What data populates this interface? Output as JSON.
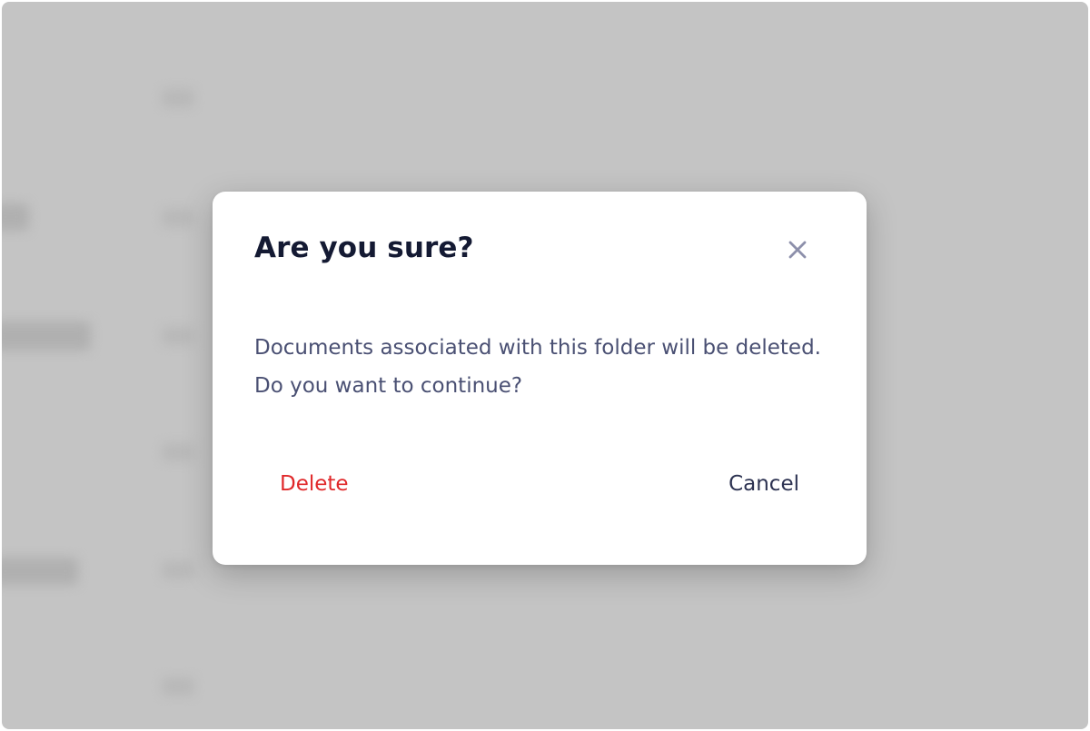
{
  "dialog": {
    "title": "Are you sure?",
    "message": "Documents associated with this folder will be deleted. Do you want to continue?",
    "delete_label": "Delete",
    "cancel_label": "Cancel",
    "close_icon": "close-icon"
  },
  "colors": {
    "overlay": "#c4c4c4",
    "danger": "#e0282a",
    "title": "#141a33",
    "body_text": "#4a5073",
    "cancel_text": "#2c3251",
    "close_icon": "#8d90ab"
  }
}
